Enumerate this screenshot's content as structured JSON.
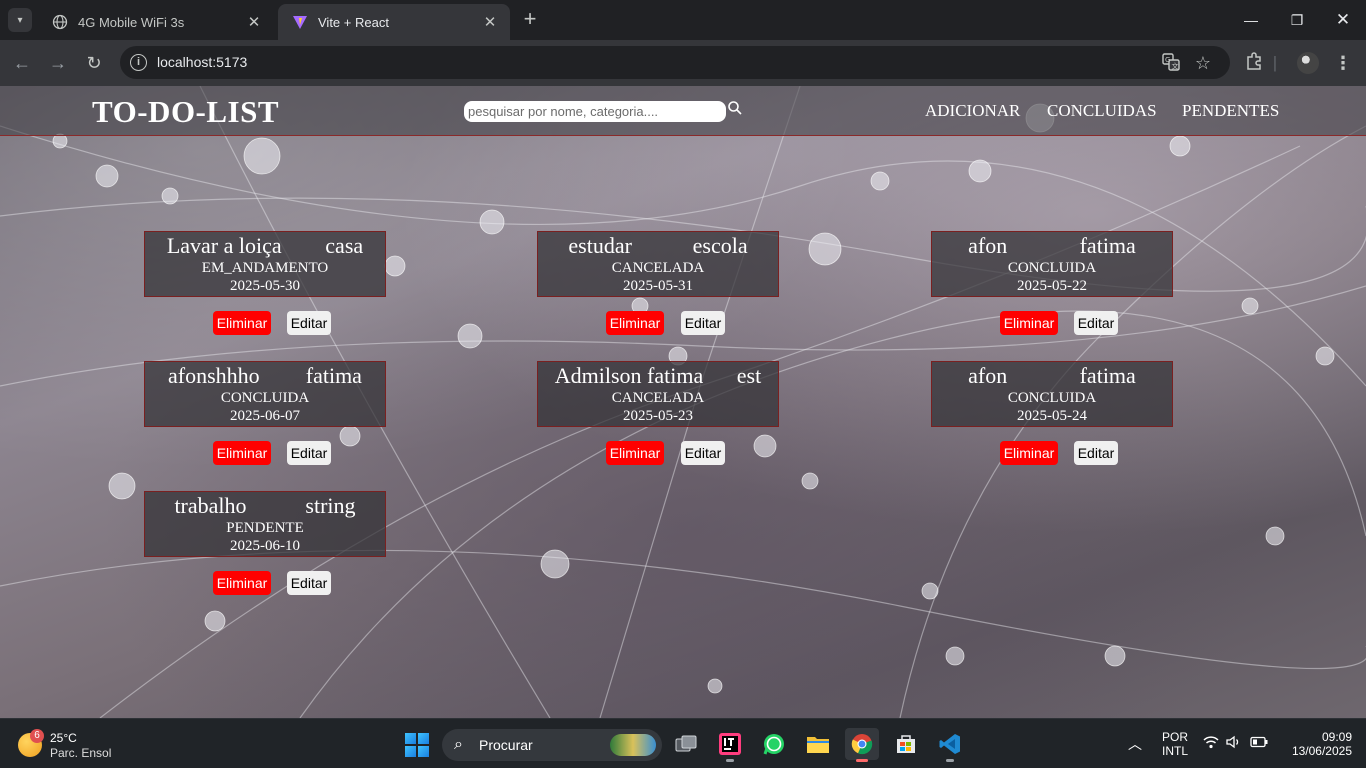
{
  "browser": {
    "tabs": [
      {
        "title": "4G Mobile WiFi 3s",
        "active": false
      },
      {
        "title": "Vite + React",
        "active": true
      }
    ],
    "url": "localhost:5173"
  },
  "app": {
    "brand": "TO-DO-LIST",
    "search_placeholder": "pesquisar por nome, categoria....",
    "nav": [
      "ADICIONAR",
      "CONCLUIDAS",
      "PENDENTES"
    ],
    "delete_label": "Eliminar",
    "edit_label": "Editar",
    "tasks": [
      {
        "name": "Lavar a loiça",
        "category": "casa",
        "status": "EM_ANDAMENTO",
        "date": "2025-05-30"
      },
      {
        "name": "estudar",
        "category": "escola",
        "status": "CANCELADA",
        "date": "2025-05-31"
      },
      {
        "name": "afon",
        "category": "fatima",
        "status": "CONCLUIDA",
        "date": "2025-05-22"
      },
      {
        "name": "afonshhho",
        "category": "fatima",
        "status": "CONCLUIDA",
        "date": "2025-06-07"
      },
      {
        "name": "Admilson fatima",
        "category": "est",
        "status": "CANCELADA",
        "date": "2025-05-23"
      },
      {
        "name": "afon",
        "category": "fatima",
        "status": "CONCLUIDA",
        "date": "2025-05-24"
      },
      {
        "name": "trabalho",
        "category": "string",
        "status": "PENDENTE",
        "date": "2025-06-10"
      }
    ]
  },
  "taskbar": {
    "weather_temp": "25°C",
    "weather_desc": "Parc. Ensol",
    "weather_badge": "6",
    "search_label": "Procurar",
    "lang_top": "POR",
    "lang_bottom": "INTL",
    "time": "09:09",
    "date": "13/06/2025"
  },
  "colors": {
    "delete_button": "#ff0000",
    "card_border": "#7a2020",
    "chrome_bg": "#202124"
  }
}
